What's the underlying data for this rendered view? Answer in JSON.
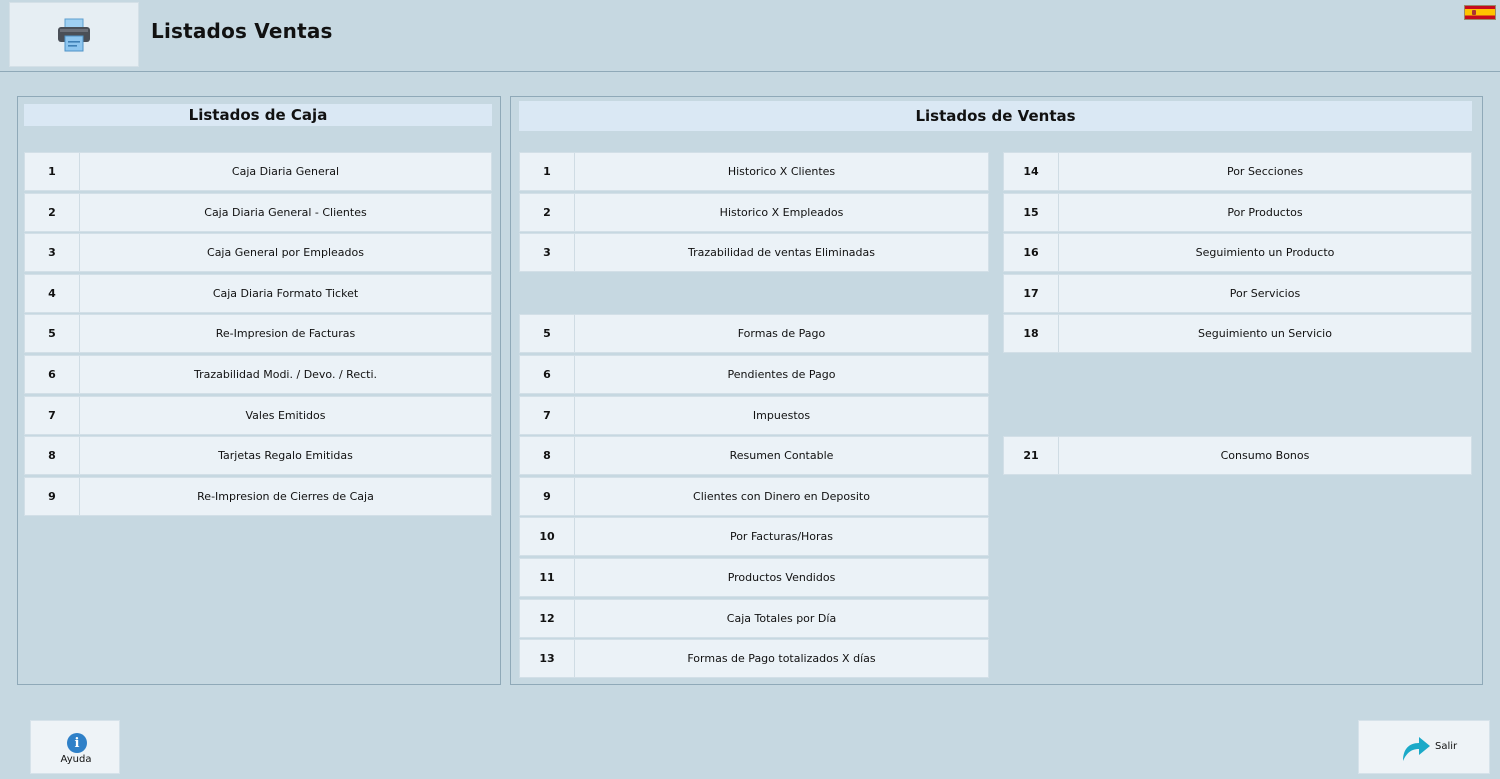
{
  "header": {
    "title": "Listados Ventas",
    "icon": "printer-icon",
    "language_flag": "spain-flag-icon"
  },
  "caja": {
    "title": "Listados de Caja",
    "items": [
      {
        "num": "1",
        "label": "Caja Diaria General"
      },
      {
        "num": "2",
        "label": "Caja Diaria General - Clientes"
      },
      {
        "num": "3",
        "label": "Caja General por Empleados"
      },
      {
        "num": "4",
        "label": "Caja Diaria Formato Ticket"
      },
      {
        "num": "5",
        "label": "Re-Impresion de Facturas"
      },
      {
        "num": "6",
        "label": "Trazabilidad Modi. / Devo. / Recti."
      },
      {
        "num": "7",
        "label": "Vales Emitidos"
      },
      {
        "num": "8",
        "label": "Tarjetas Regalo Emitidas"
      },
      {
        "num": "9",
        "label": "Re-Impresion de Cierres de Caja"
      }
    ]
  },
  "ventas": {
    "title": "Listados de Ventas",
    "left_items": [
      {
        "num": "1",
        "label": "Historico X Clientes"
      },
      {
        "num": "2",
        "label": "Historico X Empleados"
      },
      {
        "num": "3",
        "label": "Trazabilidad de ventas Eliminadas"
      },
      {
        "num": "5",
        "label": "Formas de Pago"
      },
      {
        "num": "6",
        "label": "Pendientes de Pago"
      },
      {
        "num": "7",
        "label": "Impuestos"
      },
      {
        "num": "8",
        "label": "Resumen Contable"
      },
      {
        "num": "9",
        "label": "Clientes con Dinero en Deposito"
      },
      {
        "num": "10",
        "label": "Por Facturas/Horas"
      },
      {
        "num": "11",
        "label": "Productos Vendidos"
      },
      {
        "num": "12",
        "label": "Caja Totales por Día"
      },
      {
        "num": "13",
        "label": "Formas de Pago totalizados X días"
      }
    ],
    "right_items": [
      {
        "num": "14",
        "label": "Por Secciones"
      },
      {
        "num": "15",
        "label": "Por Productos"
      },
      {
        "num": "16",
        "label": "Seguimiento un Producto"
      },
      {
        "num": "17",
        "label": "Por Servicios"
      },
      {
        "num": "18",
        "label": "Seguimiento un Servicio"
      },
      {
        "num": "21",
        "label": "Consumo Bonos"
      }
    ]
  },
  "footer": {
    "help_label": "Ayuda",
    "help_icon_text": "i",
    "exit_label": "Salir"
  },
  "colors": {
    "background": "#c6d8e1",
    "row": "#ebf2f7",
    "panel_title": "#dae8f4",
    "help_icon": "#2f80c8",
    "exit_icon": "#1aa9c8"
  }
}
